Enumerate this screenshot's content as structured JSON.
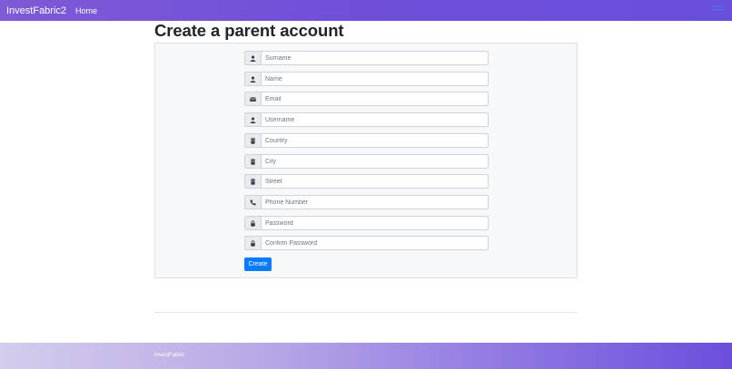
{
  "navbar": {
    "brand": "InvestFabric2",
    "links": [
      "Home"
    ]
  },
  "page": {
    "title": "Create a parent account"
  },
  "form": {
    "fields": [
      {
        "icon": "user-icon",
        "placeholder": "Surname"
      },
      {
        "icon": "user-icon",
        "placeholder": "Name"
      },
      {
        "icon": "envelope-icon",
        "placeholder": "Email"
      },
      {
        "icon": "user-icon",
        "placeholder": "Username"
      },
      {
        "icon": "building-icon",
        "placeholder": "Country"
      },
      {
        "icon": "building-icon",
        "placeholder": "City"
      },
      {
        "icon": "building-icon",
        "placeholder": "Street"
      },
      {
        "icon": "phone-icon",
        "placeholder": "Phone Number"
      },
      {
        "icon": "lock-icon",
        "placeholder": "Password"
      },
      {
        "icon": "lock-icon",
        "placeholder": "Confirm Password"
      }
    ],
    "submit_label": "Create"
  },
  "footer": {
    "text": "InvestFabric"
  },
  "colors": {
    "navbar": "#6f4fd8",
    "primary_button": "#0a7bff",
    "panel_bg": "#f7f8fa"
  }
}
